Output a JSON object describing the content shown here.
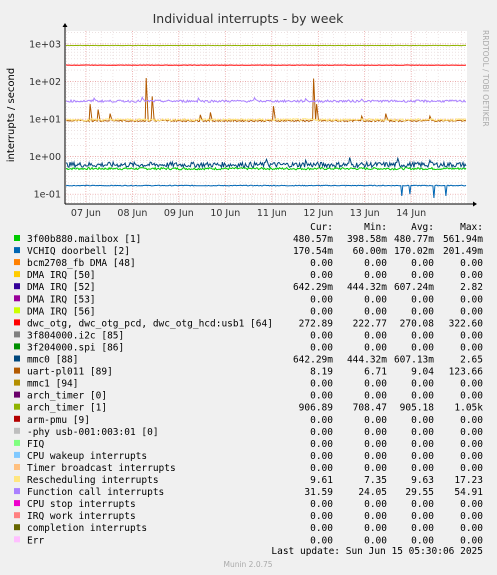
{
  "chart_data": {
    "type": "line",
    "title": "Individual interrupts - by week",
    "ylabel": "interrupts / second",
    "yscale": "log",
    "ylim": [
      0.055,
      2200
    ],
    "y_ticks": [
      {
        "v": 0.1,
        "label": "1e-01"
      },
      {
        "v": 1,
        "label": "1e+00"
      },
      {
        "v": 10,
        "label": "1e+01"
      },
      {
        "v": 100,
        "label": "1e+02"
      },
      {
        "v": 1000,
        "label": "1e+03"
      }
    ],
    "x_start": "06 Jun 14:00",
    "x_end": "15 Jun 05:30",
    "x_ticks": [
      "07 Jun",
      "08 Jun",
      "09 Jun",
      "10 Jun",
      "11 Jun",
      "12 Jun",
      "13 Jun",
      "14 Jun"
    ],
    "grid": true,
    "watermark": "RRDTOOL / TOBI OETIKER",
    "columns": [
      "Cur:",
      "Min:",
      "Avg:",
      "Max:"
    ],
    "series": [
      {
        "name": "3f00b880.mailbox [1]",
        "color": "#00cc00",
        "values": [
          "480.57m",
          "398.58m",
          "480.77m",
          "561.94m"
        ],
        "level": 0.48,
        "noise": 0.03
      },
      {
        "name": "VCHIQ doorbell [2]",
        "color": "#0066b3",
        "values": [
          "170.54m",
          "60.00m",
          "170.02m",
          "201.49m"
        ],
        "level": 0.17,
        "noise": 0.01,
        "dips": [
          [
            0.84,
            0.09
          ],
          [
            0.86,
            0.1
          ],
          [
            0.92,
            0.08
          ],
          [
            0.95,
            0.09
          ]
        ]
      },
      {
        "name": "bcm2708_fb DMA [48]",
        "color": "#ff8000",
        "values": [
          "0.00",
          "0.00",
          "0.00",
          "0.00"
        ]
      },
      {
        "name": "DMA IRQ [50]",
        "color": "#ffcc00",
        "values": [
          "0.00",
          "0.00",
          "0.00",
          "0.00"
        ]
      },
      {
        "name": "DMA IRQ [52]",
        "color": "#330099",
        "values": [
          "642.29m",
          "444.32m",
          "607.24m",
          "2.82"
        ]
      },
      {
        "name": "DMA IRQ [53]",
        "color": "#990099",
        "values": [
          "0.00",
          "0.00",
          "0.00",
          "0.00"
        ]
      },
      {
        "name": "DMA IRQ [56]",
        "color": "#ccff00",
        "values": [
          "0.00",
          "0.00",
          "0.00",
          "0.00"
        ]
      },
      {
        "name": "dwc_otg, dwc_otg_pcd, dwc_otg_hcd:usb1 [64]",
        "color": "#ff0000",
        "values": [
          "272.89",
          "222.77",
          "270.08",
          "322.60"
        ],
        "level": 272,
        "noise": 0.005
      },
      {
        "name": "3f804000.i2c [85]",
        "color": "#808080",
        "values": [
          "0.00",
          "0.00",
          "0.00",
          "0.00"
        ]
      },
      {
        "name": "3f204000.spi [86]",
        "color": "#008f00",
        "values": [
          "0.00",
          "0.00",
          "0.00",
          "0.00"
        ]
      },
      {
        "name": "mmc0 [88]",
        "color": "#00487d",
        "values": [
          "642.29m",
          "444.32m",
          "607.13m",
          "2.65"
        ],
        "level": 0.61,
        "noise": 0.07,
        "spikes": [
          [
            0.5,
            0.85
          ],
          [
            0.6,
            0.8
          ],
          [
            0.71,
            0.95
          ],
          [
            0.83,
            0.9
          ],
          [
            0.91,
            0.8
          ]
        ]
      },
      {
        "name": "uart-pl011 [89]",
        "color": "#b35a00",
        "values": [
          "8.19",
          "6.71",
          "9.04",
          "123.66"
        ],
        "level": 9.0,
        "noise": 0.02,
        "spikes": [
          [
            0.06,
            25
          ],
          [
            0.08,
            18
          ],
          [
            0.11,
            14
          ],
          [
            0.2,
            124
          ],
          [
            0.215,
            40
          ],
          [
            0.335,
            13
          ],
          [
            0.36,
            15
          ],
          [
            0.52,
            22
          ],
          [
            0.62,
            120
          ],
          [
            0.627,
            25
          ],
          [
            0.74,
            12
          ],
          [
            0.8,
            14
          ],
          [
            0.91,
            12
          ]
        ]
      },
      {
        "name": "mmc1 [94]",
        "color": "#b38f00",
        "values": [
          "0.00",
          "0.00",
          "0.00",
          "0.00"
        ]
      },
      {
        "name": "arch_timer [0]",
        "color": "#6b006b",
        "values": [
          "0.00",
          "0.00",
          "0.00",
          "0.00"
        ]
      },
      {
        "name": "arch_timer [1]",
        "color": "#8fb300",
        "values": [
          "906.89",
          "708.47",
          "905.18",
          "1.05k"
        ],
        "level": 905,
        "noise": 0.004
      },
      {
        "name": "arm-pmu [9]",
        "color": "#b30000",
        "values": [
          "0.00",
          "0.00",
          "0.00",
          "0.00"
        ]
      },
      {
        "name": "-phy       usb-001:003:01 [0]",
        "color": "#bebebe",
        "values": [
          "0.00",
          "0.00",
          "0.00",
          "0.00"
        ]
      },
      {
        "name": "FIQ",
        "color": "#80ff80",
        "values": [
          "0.00",
          "0.00",
          "0.00",
          "0.00"
        ]
      },
      {
        "name": "CPU wakeup interrupts",
        "color": "#80c9ff",
        "values": [
          "0.00",
          "0.00",
          "0.00",
          "0.00"
        ]
      },
      {
        "name": "Timer broadcast interrupts",
        "color": "#ffc080",
        "values": [
          "0.00",
          "0.00",
          "0.00",
          "0.00"
        ]
      },
      {
        "name": "Rescheduling interrupts",
        "color": "#ffe680",
        "values": [
          "9.61",
          "7.35",
          "9.63",
          "17.23"
        ],
        "level": 9.6,
        "noise": 0.03
      },
      {
        "name": "Function call interrupts",
        "color": "#aa80ff",
        "values": [
          "31.59",
          "24.05",
          "29.55",
          "54.91"
        ],
        "level": 30,
        "noise": 0.03,
        "spikes": [
          [
            0.07,
            36
          ],
          [
            0.19,
            38
          ],
          [
            0.33,
            36
          ],
          [
            0.47,
            37
          ],
          [
            0.6,
            35
          ],
          [
            0.74,
            34
          ]
        ]
      },
      {
        "name": "CPU stop interrupts",
        "color": "#ee00cc",
        "values": [
          "0.00",
          "0.00",
          "0.00",
          "0.00"
        ]
      },
      {
        "name": "IRQ work interrupts",
        "color": "#ff8080",
        "values": [
          "0.00",
          "0.00",
          "0.00",
          "0.00"
        ]
      },
      {
        "name": "completion interrupts",
        "color": "#666600",
        "values": [
          "0.00",
          "0.00",
          "0.00",
          "0.00"
        ]
      },
      {
        "name": "Err",
        "color": "#ffbfff",
        "values": [
          "0.00",
          "0.00",
          "0.00",
          "0.00"
        ]
      }
    ]
  },
  "footer": {
    "last_update": "Last update: Sun Jun 15 05:30:06 2025",
    "version": "Munin 2.0.75"
  }
}
